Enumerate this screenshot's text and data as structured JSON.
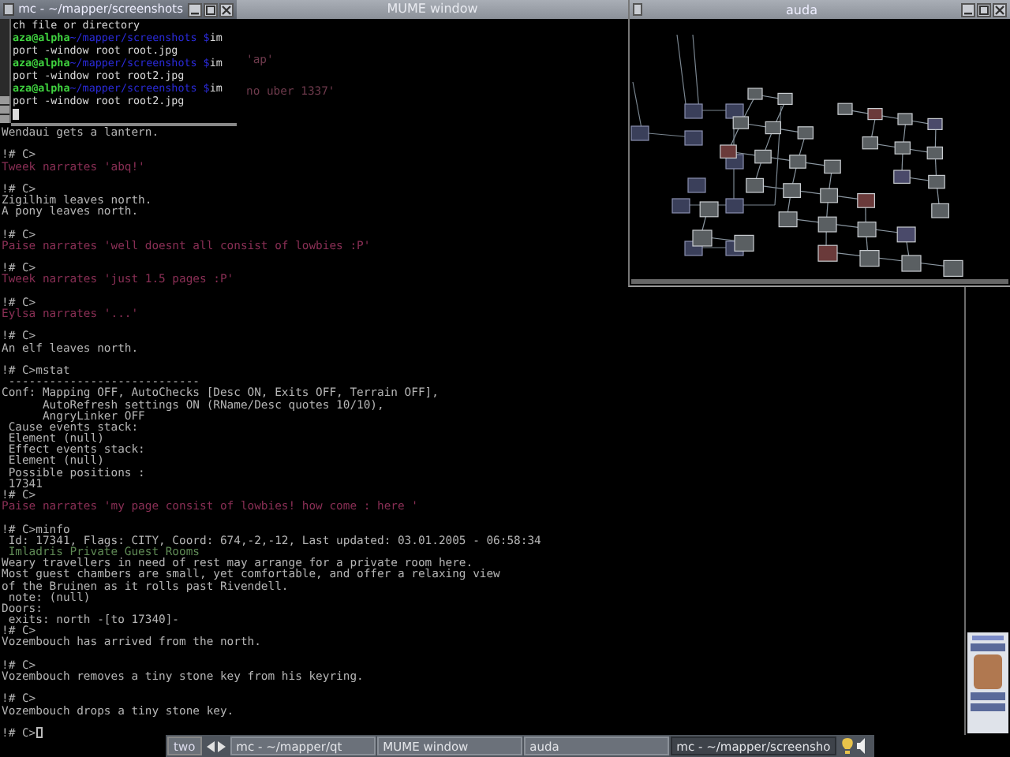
{
  "mume_window": {
    "title": "MUME window",
    "fragments": [
      "'ap'",
      "no uber 1337'"
    ],
    "lines": [
      {
        "kind": "normal",
        "text": "Wendaui gets a lantern."
      },
      {
        "kind": "blank"
      },
      {
        "kind": "normal",
        "text": "!# C>"
      },
      {
        "kind": "narrate",
        "text": "Tweek narrates 'abq!'"
      },
      {
        "kind": "blank"
      },
      {
        "kind": "normal",
        "text": "!# C>"
      },
      {
        "kind": "normal",
        "text": "Zigilhim leaves north."
      },
      {
        "kind": "normal",
        "text": "A pony leaves north."
      },
      {
        "kind": "blank"
      },
      {
        "kind": "normal",
        "text": "!# C>"
      },
      {
        "kind": "narrate",
        "text": "Paise narrates 'well doesnt all consist of lowbies :P'"
      },
      {
        "kind": "blank"
      },
      {
        "kind": "normal",
        "text": "!# C>"
      },
      {
        "kind": "narrate",
        "text": "Tweek narrates 'just 1.5 pages :P'"
      },
      {
        "kind": "blank"
      },
      {
        "kind": "normal",
        "text": "!# C>"
      },
      {
        "kind": "narrate",
        "text": "Eylsa narrates '...'"
      },
      {
        "kind": "blank"
      },
      {
        "kind": "normal",
        "text": "!# C>"
      },
      {
        "kind": "normal",
        "text": "An elf leaves north."
      },
      {
        "kind": "blank"
      },
      {
        "kind": "normal",
        "text": "!# C>mstat"
      },
      {
        "kind": "normal",
        "text": " ----------------------------"
      },
      {
        "kind": "normal",
        "text": "Conf: Mapping OFF, AutoChecks [Desc ON, Exits OFF, Terrain OFF],"
      },
      {
        "kind": "normal",
        "text": "      AutoRefresh settings ON (RName/Desc quotes 10/10),"
      },
      {
        "kind": "normal",
        "text": "      AngryLinker OFF"
      },
      {
        "kind": "normal",
        "text": " Cause events stack:"
      },
      {
        "kind": "normal",
        "text": " Element (null)"
      },
      {
        "kind": "normal",
        "text": " Effect events stack:"
      },
      {
        "kind": "normal",
        "text": " Element (null)"
      },
      {
        "kind": "normal",
        "text": " Possible positions :"
      },
      {
        "kind": "normal",
        "text": " 17341"
      },
      {
        "kind": "normal",
        "text": "!# C>"
      },
      {
        "kind": "narrate",
        "text": "Paise narrates 'my page consist of lowbies! how come : here '"
      },
      {
        "kind": "blank"
      },
      {
        "kind": "normal",
        "text": "!# C>minfo"
      },
      {
        "kind": "normal",
        "text": " Id: 17341, Flags: CITY, Coord: 674,-2,-12, Last updated: 03.01.2005 - 06:58:34"
      },
      {
        "kind": "room",
        "text": " Imladris Private Guest Rooms"
      },
      {
        "kind": "normal",
        "text": "Weary travellers in need of rest may arrange for a private room here."
      },
      {
        "kind": "normal",
        "text": "Most guest chambers are small, yet comfortable, and offer a relaxing view"
      },
      {
        "kind": "normal",
        "text": "of the Bruinen as it rolls past Rivendell."
      },
      {
        "kind": "normal",
        "text": " note: (null)"
      },
      {
        "kind": "normal",
        "text": "Doors:"
      },
      {
        "kind": "normal",
        "text": " exits: north -[to 17340]-"
      },
      {
        "kind": "normal",
        "text": "!# C>"
      },
      {
        "kind": "normal",
        "text": "Vozembouch has arrived from the north."
      },
      {
        "kind": "blank"
      },
      {
        "kind": "normal",
        "text": "!# C>"
      },
      {
        "kind": "normal",
        "text": "Vozembouch removes a tiny stone key from his keyring."
      },
      {
        "kind": "blank"
      },
      {
        "kind": "normal",
        "text": "!# C>"
      },
      {
        "kind": "normal",
        "text": "Vozembouch drops a tiny stone key."
      },
      {
        "kind": "blank"
      },
      {
        "kind": "input",
        "text": "!# C>"
      }
    ]
  },
  "xterm_window": {
    "title": "mc - ~/mapper/screenshots",
    "lines": [
      {
        "kind": "output",
        "text": "ch file or directory"
      },
      {
        "kind": "prompt",
        "user": "aza@alpha",
        "path": "~/mapper/screenshots $",
        "text": "im"
      },
      {
        "kind": "output",
        "text": "port -window root root.jpg"
      },
      {
        "kind": "prompt",
        "user": "aza@alpha",
        "path": "~/mapper/screenshots $",
        "text": "im"
      },
      {
        "kind": "output",
        "text": "port -window root root2.jpg"
      },
      {
        "kind": "prompt",
        "user": "aza@alpha",
        "path": "~/mapper/screenshots $",
        "text": "im"
      },
      {
        "kind": "output",
        "text": "port -window root root2.jpg"
      },
      {
        "kind": "cursor"
      }
    ]
  },
  "map_window": {
    "title": "auda"
  },
  "taskbar": {
    "desk": "two",
    "tasks": [
      {
        "label": "mc - ~/mapper/qt",
        "selected": false
      },
      {
        "label": "MUME window",
        "selected": false
      },
      {
        "label": "auda",
        "selected": false
      },
      {
        "label": "mc - ~/mapper/screensho",
        "selected": true
      }
    ]
  }
}
